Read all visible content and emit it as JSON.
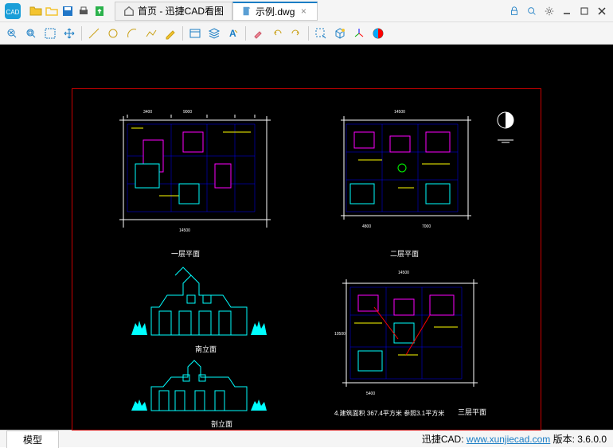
{
  "app": {
    "name": "迅捷CAD"
  },
  "tabs": {
    "home_label": "首页 - 迅捷CAD看图",
    "file_label": "示例.dwg"
  },
  "drawing": {
    "plan1_label": "一层平面",
    "plan2_label": "二层平面",
    "plan3_label": "三层平面",
    "elev1_label": "南立面",
    "elev2_label": "剖立面",
    "info_line": "4.建筑面积 367.4平方米 参照3.1平方米"
  },
  "statusbar": {
    "model_tab": "模型",
    "brand": "迅捷CAD: ",
    "url": "www.xunjiecad.com",
    "version_label": " 版本: ",
    "version": "3.6.0.0"
  }
}
